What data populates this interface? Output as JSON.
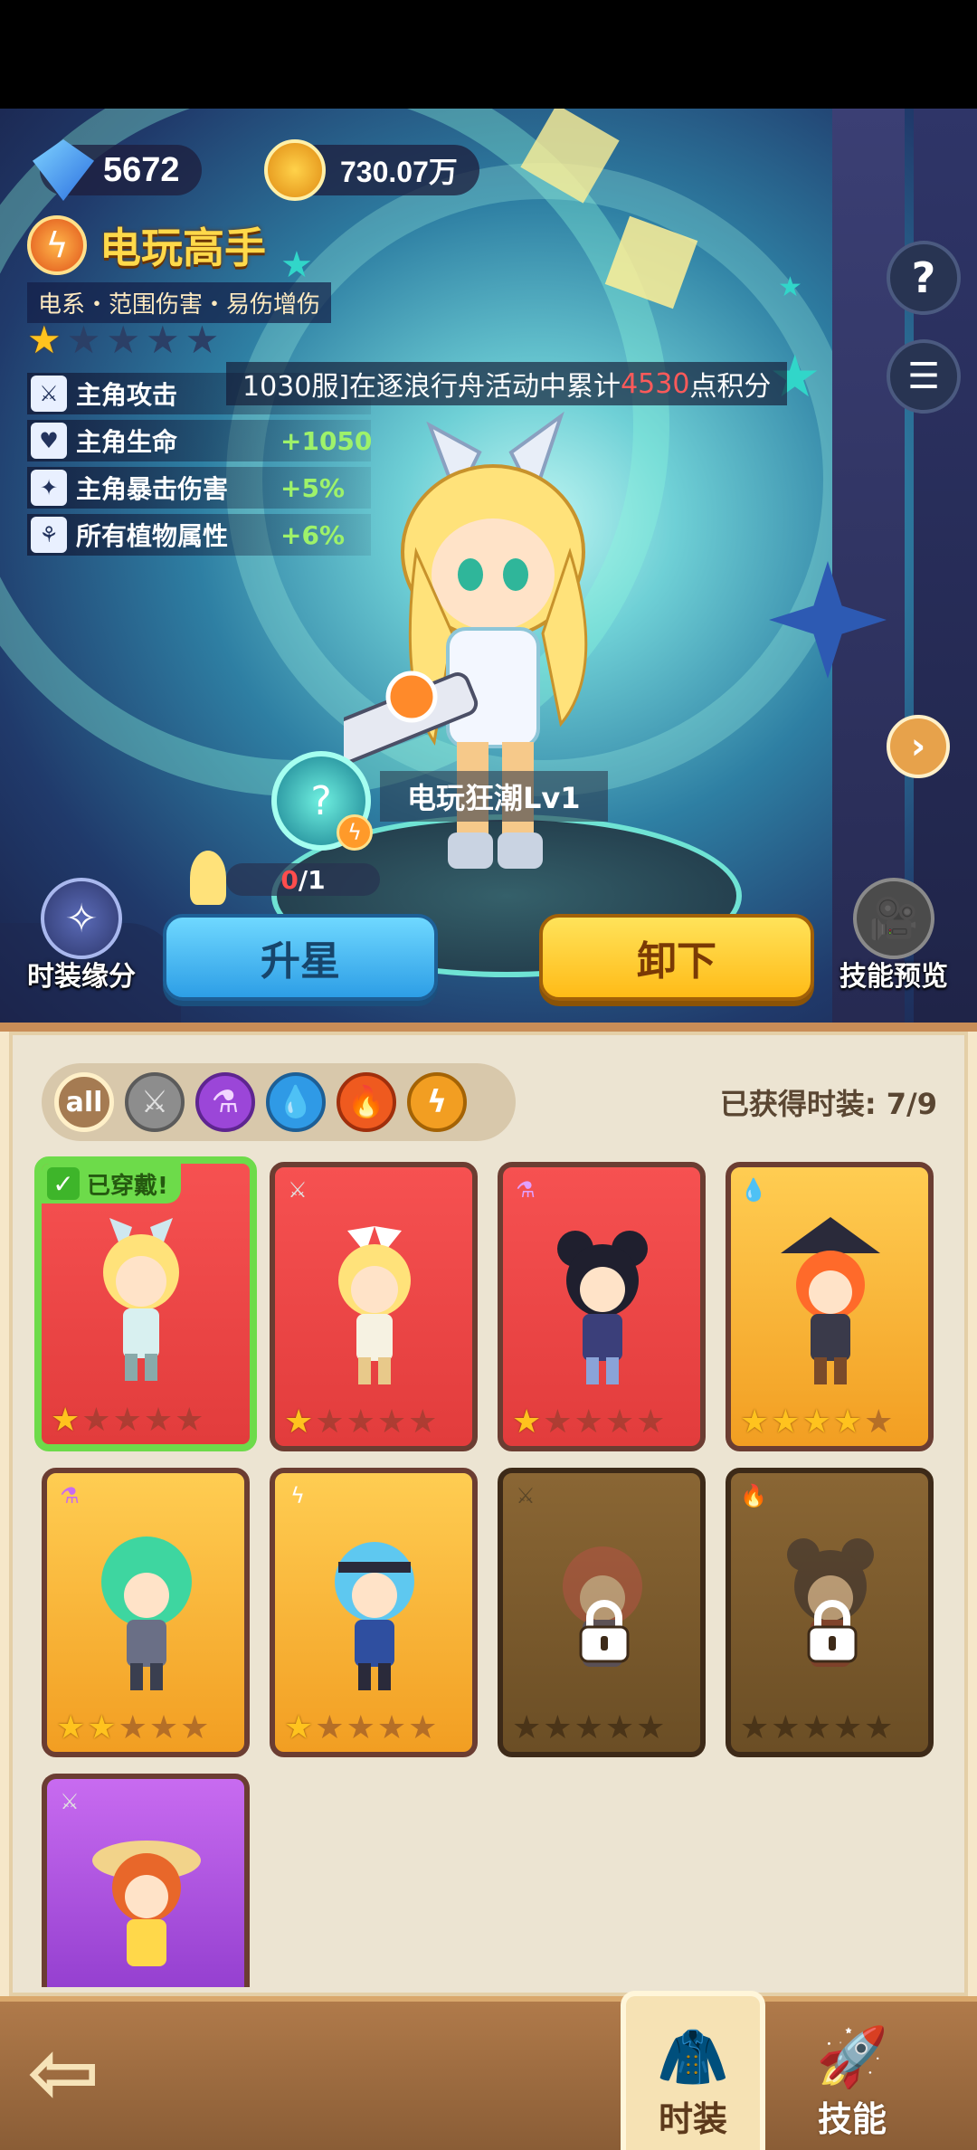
{
  "currency": {
    "gems": "5672",
    "gold": "730.07万",
    "gem_icon": "diamond-gem-icon",
    "gold_icon": "gold-coin-icon"
  },
  "hero": {
    "title": "电玩高手",
    "subtitle": "电系・范围伤害・易伤增伤",
    "stars_filled": 1,
    "stars_total": 5,
    "stats": [
      {
        "label": "主角攻击",
        "value": "",
        "icon": "sword-icon"
      },
      {
        "label": "主角生命",
        "value": "+1050",
        "icon": "heart-icon"
      },
      {
        "label": "主角暴击伤害",
        "value": "+5%",
        "icon": "crit-icon"
      },
      {
        "label": "所有植物属性",
        "value": "+6%",
        "icon": "plant-icon"
      }
    ],
    "banner": {
      "prefix": "1030服]在逐浪行舟活动中累计",
      "highlight": "4530",
      "suffix": "点积分"
    },
    "skill_name": "电玩狂潮Lv1",
    "progress": {
      "current": "0",
      "total": "/1"
    }
  },
  "buttons": {
    "fashion_bond": "时装缘分",
    "upgrade_star": "升星",
    "unequip": "卸下",
    "skill_preview": "技能预览"
  },
  "filters": {
    "all_label": "all",
    "owned_text": "已获得时装: 7/9"
  },
  "cards": [
    {
      "type": "red",
      "element": "all",
      "stars": 1,
      "equipped": true,
      "equip_tag": "已穿戴!"
    },
    {
      "type": "red",
      "element": "sword",
      "stars": 1
    },
    {
      "type": "red",
      "element": "potion",
      "stars": 1
    },
    {
      "type": "yellow",
      "element": "water",
      "stars": 4
    },
    {
      "type": "yellow",
      "element": "potion",
      "stars": 2
    },
    {
      "type": "yellow",
      "element": "bolt",
      "stars": 1
    },
    {
      "type": "locked",
      "element": "sword",
      "stars": 0
    },
    {
      "type": "locked",
      "element": "fire",
      "stars": 0
    },
    {
      "type": "purple",
      "element": "sword",
      "stars": 0
    }
  ],
  "nav": {
    "fashion": "时装",
    "skills": "技能"
  },
  "colors": {
    "accent_gold": "#ffd94a",
    "stat_green": "#9ef26a",
    "highlight_red": "#ff5a5a",
    "equipped_green": "#6ddb4a"
  }
}
